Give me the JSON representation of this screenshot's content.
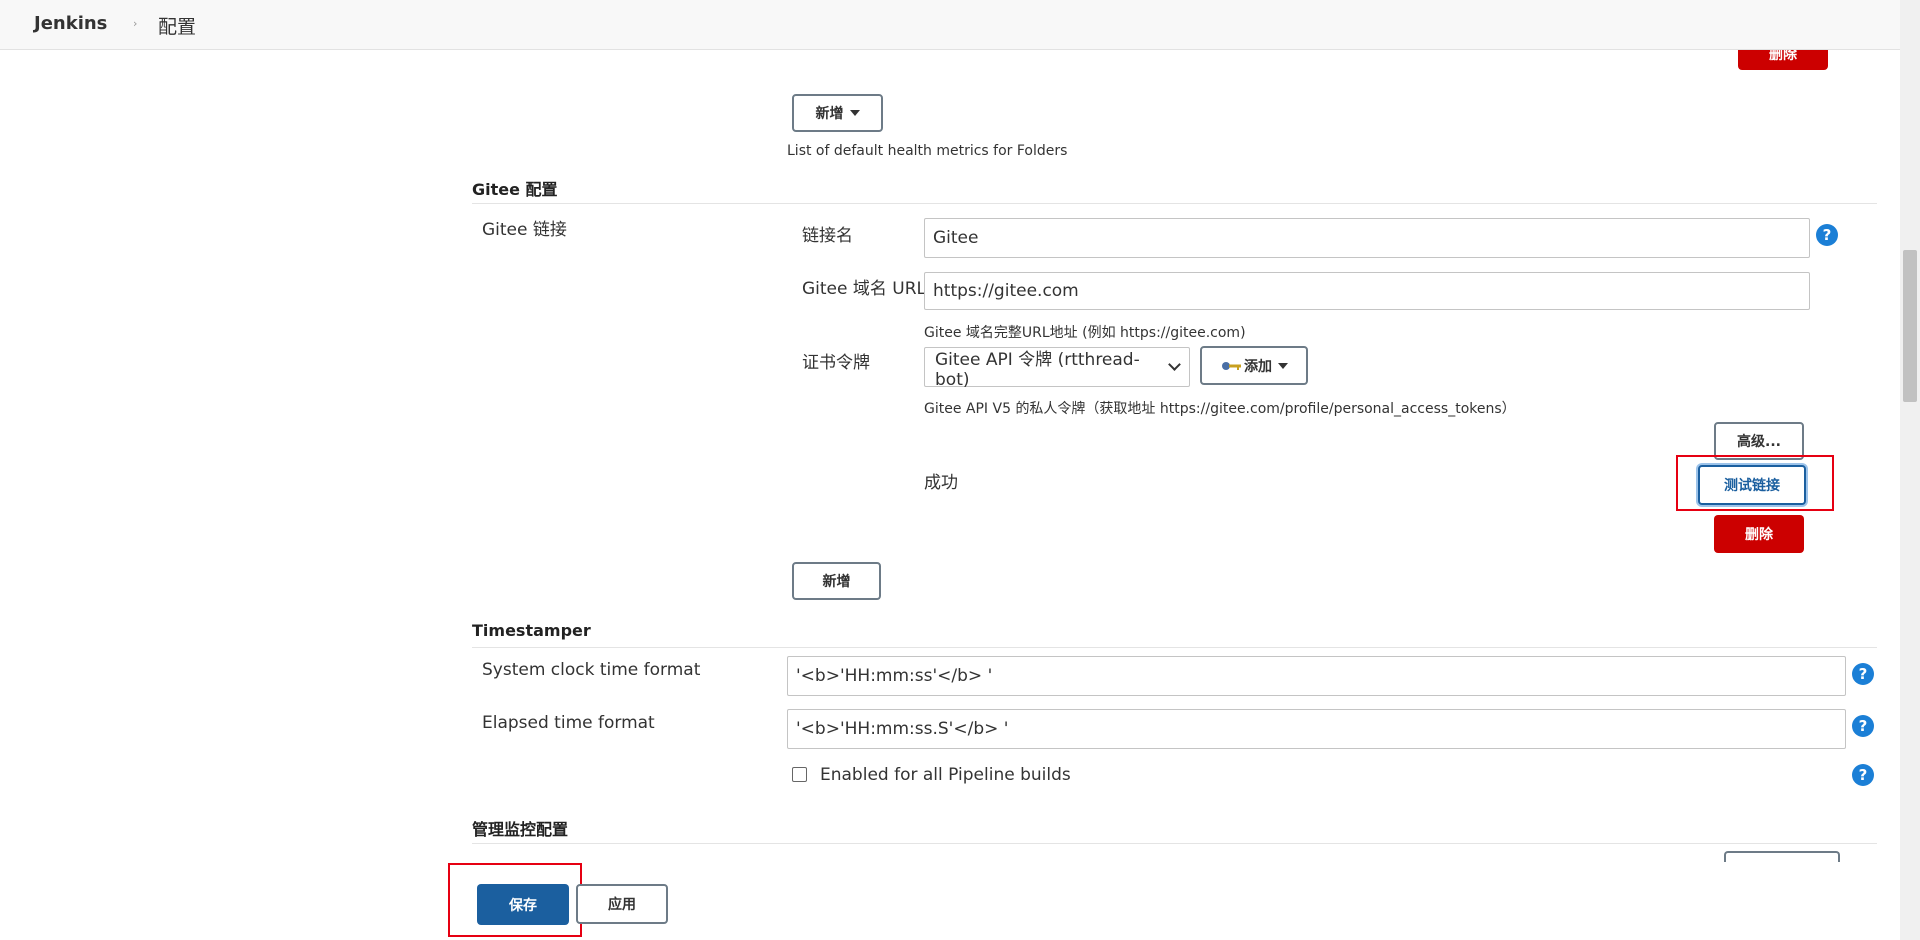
{
  "header": {
    "brand": "Jenkins",
    "separator": "›",
    "page": "配置"
  },
  "health_metrics": {
    "add_label": "新增",
    "description": "List of default health metrics for Folders"
  },
  "top_delete_label": "删除",
  "gitee": {
    "section_title": "Gitee 配置",
    "group_label": "Gitee 链接",
    "name_label": "链接名",
    "name_value": "Gitee",
    "url_label": "Gitee 域名 URL",
    "url_value": "https://gitee.com",
    "url_hint": "Gitee 域名完整URL地址 (例如 https://gitee.com)",
    "token_label": "证书令牌",
    "token_selected": "Gitee API 令牌 (rtthread-bot)",
    "add_label": "添加",
    "token_hint": "Gitee API V5 的私人令牌（获取地址 https://gitee.com/profile/personal_access_tokens）",
    "advanced_label": "高级...",
    "status_text": "成功",
    "test_label": "测试链接",
    "delete_label": "删除",
    "new_label": "新增"
  },
  "timestamper": {
    "section_title": "Timestamper",
    "clock_label": "System clock time format",
    "clock_value": "'<b>'HH:mm:ss'</b> '",
    "elapsed_label": "Elapsed time format",
    "elapsed_value": "'<b>'HH:mm:ss.S'</b> '",
    "pipeline_label": "Enabled for all Pipeline builds"
  },
  "monitor": {
    "section_title": "管理监控配置"
  },
  "footer": {
    "save_label": "保存",
    "apply_label": "应用"
  },
  "help_glyph": "?",
  "colors": {
    "accent_blue": "#1b5f9f",
    "danger_red": "#cc0000",
    "help_blue": "#1b7fd6",
    "highlight_red": "#e60012"
  }
}
